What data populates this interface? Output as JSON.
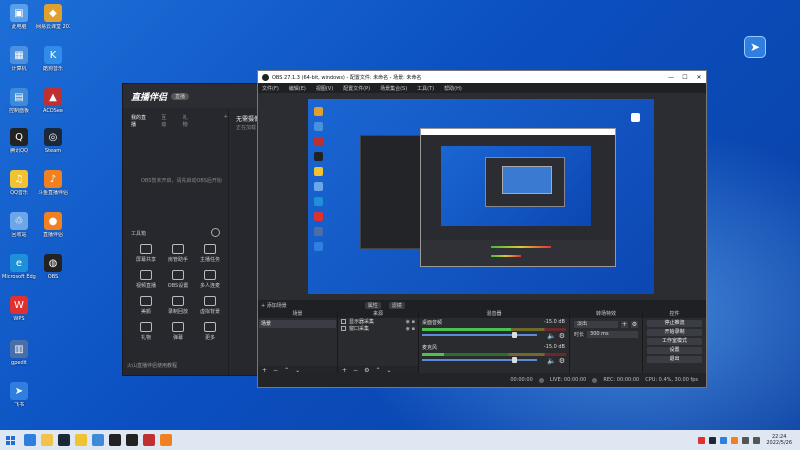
{
  "desktop": {
    "icons": [
      {
        "label": "此电脑",
        "color": "#5aa0e8",
        "glyph": "▣"
      },
      {
        "label": "网易云课堂\n2022",
        "color": "#e0a030",
        "glyph": "◆"
      },
      {
        "label": "计算机",
        "color": "#4b8fe0",
        "glyph": "▦"
      },
      {
        "label": "酷狗音乐",
        "color": "#2f8ce8",
        "glyph": "K"
      },
      {
        "label": "控制面板",
        "color": "#3c8ad8",
        "glyph": "▤"
      },
      {
        "label": "ACDSee",
        "color": "#c03030",
        "glyph": "▲"
      },
      {
        "label": "腾讯QQ",
        "color": "#222222",
        "glyph": "Q"
      },
      {
        "label": "Steam",
        "color": "#1b2838",
        "glyph": "◎"
      },
      {
        "label": "QQ音乐",
        "color": "#f1c232",
        "glyph": "♫"
      },
      {
        "label": "斗鱼直播伴侣",
        "color": "#f08020",
        "glyph": "♪"
      },
      {
        "label": "回收站",
        "color": "#6ca6e8",
        "glyph": "♲"
      },
      {
        "label": "直播伴侣",
        "color": "#f08020",
        "glyph": "●"
      },
      {
        "label": "Microsoft\nEdge",
        "color": "#1e90d8",
        "glyph": "e"
      },
      {
        "label": "OBS",
        "color": "#222222",
        "glyph": "◍"
      },
      {
        "label": "WPS",
        "color": "#e03030",
        "glyph": "W"
      },
      {
        "label": "gpedit",
        "color": "#4a6fa8",
        "glyph": "▥"
      },
      {
        "label": "飞书",
        "color": "#2f7fe0",
        "glyph": "➤"
      }
    ]
  },
  "live_app": {
    "logo": "直播伴侣",
    "badge": "直播",
    "tabs": [
      "我的直播",
      "互动",
      "礼物",
      "+"
    ],
    "empty_text": "OBS暂未开启，请先启动OBS后开始",
    "right_title": "无需摄像头",
    "right_sub": "正在加载",
    "tools_title": "工具箱",
    "tools": [
      "屏幕共享",
      "房管助手",
      "主播任务",
      "视频直播",
      "OBS设置",
      "多人连麦",
      "美颜",
      "录制回放",
      "虚拟背景",
      "礼物",
      "弹幕",
      "更多"
    ],
    "footer": "火山直播伴侣使用教程"
  },
  "obs": {
    "title": "OBS 27.1.3 (64-bit, windows) - 配置文件: 未命名 - 场景: 未命名",
    "menu": [
      "文件(F)",
      "编辑(E)",
      "视图(V)",
      "配置文件(P)",
      "场景集合(S)",
      "工具(T)",
      "帮助(H)"
    ],
    "scene_bar": {
      "add": "+ 添加场景",
      "props": "属性",
      "filters": "滤镜"
    },
    "docks": {
      "scenes": {
        "title": "场景",
        "items": [
          "场景"
        ]
      },
      "sources": {
        "title": "来源",
        "items": [
          "显示器采集",
          "窗口采集"
        ]
      },
      "mixer": {
        "title": "混音器",
        "channels": [
          {
            "name": "桌面音频",
            "db": "-15.0 dB",
            "level": 0.62
          },
          {
            "name": "麦克风",
            "db": "-15.0 dB",
            "level": 0.15
          }
        ]
      },
      "transitions": {
        "title": "转场特效",
        "type": "淡出",
        "duration_label": "时长",
        "duration": "300 ms"
      },
      "controls": {
        "title": "控件",
        "buttons": [
          "停止推流",
          "开始录制",
          "工作室模式",
          "设置",
          "退出"
        ]
      }
    },
    "status": {
      "live": "LIVE: 00:00:00",
      "rec": "REC: 00:00:00",
      "cpu": "CPU: 0.4%, 30.00 fps",
      "dropped": "00:00:00"
    }
  },
  "taskbar": {
    "apps": [
      {
        "name": "start",
        "color": "#1d6fd8"
      },
      {
        "name": "feishu",
        "color": "#2f7fe0"
      },
      {
        "name": "folder",
        "color": "#f2c14e"
      },
      {
        "name": "steam",
        "color": "#1b2838"
      },
      {
        "name": "qqmusic",
        "color": "#f1c232"
      },
      {
        "name": "settings",
        "color": "#3c8ad8"
      },
      {
        "name": "qq",
        "color": "#222222"
      },
      {
        "name": "obs",
        "color": "#222222"
      },
      {
        "name": "acdsee",
        "color": "#c03030"
      },
      {
        "name": "live",
        "color": "#f08020"
      }
    ],
    "time": "22:24",
    "date": "2022/5/26"
  }
}
